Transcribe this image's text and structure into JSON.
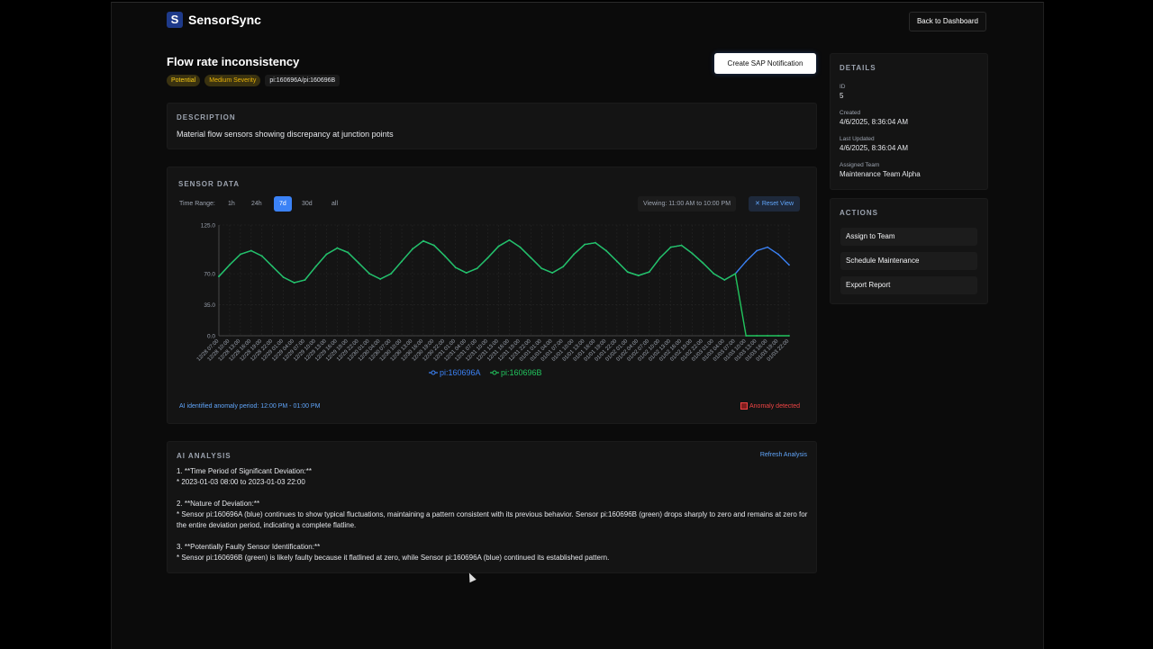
{
  "app": {
    "name": "SensorSync",
    "logo_letter": "S",
    "back_label": "Back to Dashboard"
  },
  "incident": {
    "title": "Flow rate inconsistency",
    "badges": [
      "Potential",
      "Medium Severity",
      "pi:160696A/pi:160696B"
    ],
    "sap_button": "Create SAP Notification",
    "description_title": "DESCRIPTION",
    "description": "Material flow sensors showing discrepancy at junction points"
  },
  "sensor": {
    "title": "SENSOR DATA",
    "time_range_label": "Time Range:",
    "ranges": [
      "1h",
      "24h",
      "7d",
      "30d",
      "all"
    ],
    "active_range": "7d",
    "viewing": "Viewing: 11:00 AM to 10:00 PM",
    "reset": "Reset View",
    "anomaly_period": "AI identified anomaly period: 12:00 PM - 01:00 PM",
    "anomaly_detected": "Anomaly detected"
  },
  "chart_data": {
    "type": "line",
    "ylim": [
      0,
      125
    ],
    "yticks": [
      "125.0",
      "70.0",
      "35.0",
      "0.0"
    ],
    "xticks": [
      "12/28 07:00",
      "12/28 10:00",
      "12/28 13:00",
      "12/28 16:00",
      "12/28 19:00",
      "12/28 22:00",
      "12/29 01:00",
      "12/29 04:00",
      "12/29 07:00",
      "12/29 10:00",
      "12/29 13:00",
      "12/29 16:00",
      "12/29 19:00",
      "12/29 22:00",
      "12/30 01:00",
      "12/30 04:00",
      "12/30 07:00",
      "12/30 10:00",
      "12/30 13:00",
      "12/30 16:00",
      "12/30 19:00",
      "12/30 22:00",
      "12/31 01:00",
      "12/31 04:00",
      "12/31 07:00",
      "12/31 10:00",
      "12/31 13:00",
      "12/31 16:00",
      "12/31 19:00",
      "12/31 22:00",
      "01/01 01:00",
      "01/01 04:00",
      "01/01 07:00",
      "01/01 10:00",
      "01/01 13:00",
      "01/01 16:00",
      "01/01 19:00",
      "01/01 22:00",
      "01/02 01:00",
      "01/02 04:00",
      "01/02 07:00",
      "01/02 10:00",
      "01/02 13:00",
      "01/02 16:00",
      "01/02 19:00",
      "01/02 22:00",
      "01/03 01:00",
      "01/03 04:00",
      "01/03 07:00",
      "01/03 10:00",
      "01/03 13:00",
      "01/03 16:00",
      "01/03 19:00",
      "01/03 22:00"
    ],
    "series": [
      {
        "name": "pi:160696A",
        "color": "#3b82f6",
        "values": [
          67,
          80,
          92,
          96,
          90,
          78,
          66,
          60,
          63,
          78,
          92,
          99,
          94,
          82,
          70,
          64,
          70,
          84,
          98,
          107,
          102,
          90,
          77,
          71,
          76,
          88,
          101,
          108,
          100,
          88,
          76,
          71,
          78,
          92,
          103,
          105,
          96,
          84,
          72,
          68,
          72,
          88,
          100,
          102,
          93,
          82,
          70,
          63,
          70,
          84,
          96,
          100,
          92,
          80
        ]
      },
      {
        "name": "pi:160696B",
        "color": "#22c55e",
        "values": [
          67,
          80,
          92,
          96,
          90,
          78,
          66,
          60,
          63,
          78,
          92,
          99,
          94,
          82,
          70,
          64,
          70,
          84,
          98,
          107,
          102,
          90,
          77,
          71,
          76,
          88,
          101,
          108,
          100,
          88,
          76,
          71,
          78,
          92,
          103,
          105,
          96,
          84,
          72,
          68,
          72,
          88,
          100,
          102,
          93,
          82,
          70,
          63,
          70,
          0,
          0,
          0,
          0,
          0
        ]
      }
    ]
  },
  "ai": {
    "title": "AI ANALYSIS",
    "refresh": "Refresh Analysis",
    "lines": [
      "1. **Time Period of Significant Deviation:**",
      "* 2023-01-03 08:00 to 2023-01-03 22:00",
      "2. **Nature of Deviation:**",
      "* Sensor pi:160696A (blue) continues to show typical fluctuations, maintaining a pattern consistent with its previous behavior. Sensor pi:160696B (green) drops sharply to zero and remains at zero for the entire deviation period, indicating a complete flatline.",
      "3. **Potentially Faulty Sensor Identification:**",
      "* Sensor pi:160696B (green) is likely faulty because it flatlined at zero, while Sensor pi:160696A (blue) continued its established pattern."
    ]
  },
  "details": {
    "title": "DETAILS",
    "id_label": "ID",
    "id": "5",
    "created_label": "Created",
    "created": "4/6/2025, 8:36:04 AM",
    "updated_label": "Last Updated",
    "updated": "4/6/2025, 8:36:04 AM",
    "team_label": "Assigned Team",
    "team": "Maintenance Team Alpha"
  },
  "actions": {
    "title": "ACTIONS",
    "items": [
      "Assign to Team",
      "Schedule Maintenance",
      "Export Report"
    ]
  }
}
